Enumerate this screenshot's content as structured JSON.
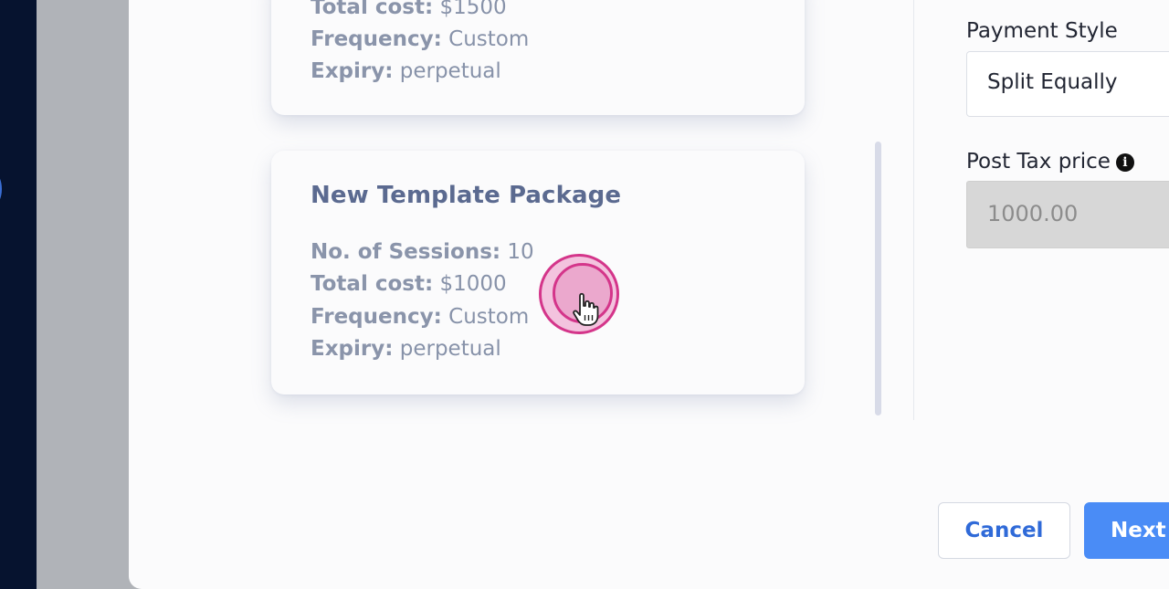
{
  "packages": [
    {
      "title": "",
      "details": [
        {
          "key": "Total cost:",
          "value": "$1500"
        },
        {
          "key": "Frequency:",
          "value": "Custom"
        },
        {
          "key": "Expiry:",
          "value": "perpetual"
        }
      ]
    },
    {
      "title": "New Template Package",
      "details": [
        {
          "key": "No. of Sessions:",
          "value": "10"
        },
        {
          "key": "Total cost:",
          "value": "$1000"
        },
        {
          "key": "Frequency:",
          "value": "Custom"
        },
        {
          "key": "Expiry:",
          "value": "perpetual"
        }
      ]
    }
  ],
  "form": {
    "payment_style_label": "Payment Style",
    "payment_style_value": "Split Equally",
    "post_tax_label": "Post Tax price",
    "post_tax_info_icon": "info-icon",
    "post_tax_value": "1000.00"
  },
  "actions": {
    "cancel_label": "Cancel",
    "next_label": "Next"
  },
  "colors": {
    "sidebar": "#06132f",
    "title": "#5b6a90",
    "accent": "#4a8cf6",
    "cursor_highlight": "#d4358a"
  }
}
